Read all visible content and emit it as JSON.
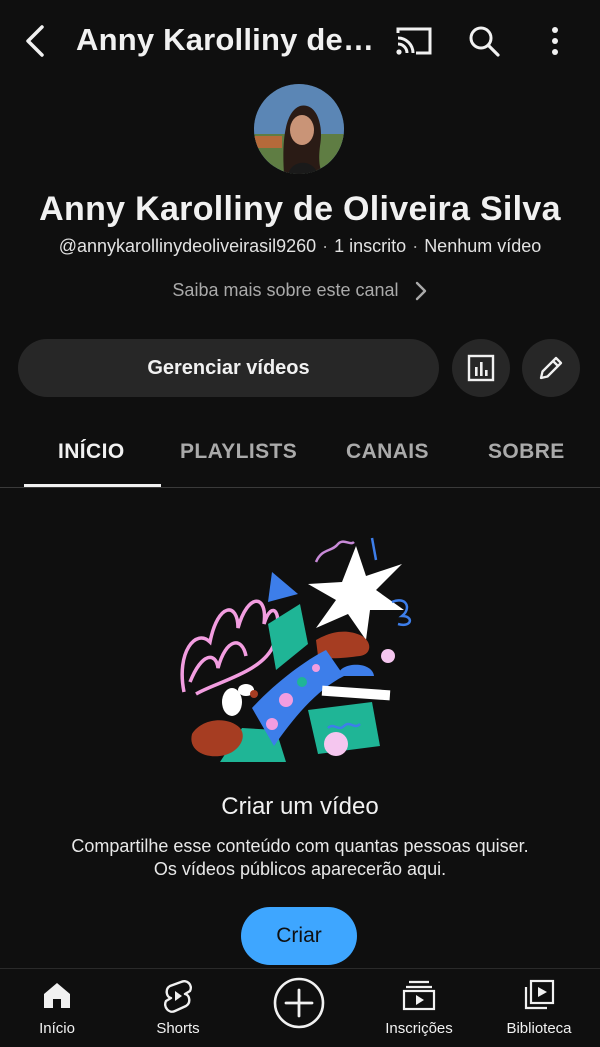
{
  "header": {
    "title": "Anny Karolliny de Oliveira Silva",
    "icons": [
      "back-icon",
      "cast-icon",
      "search-icon",
      "more-vert-icon"
    ]
  },
  "channel": {
    "name": "Anny Karolliny de Oliveira Silva",
    "handle": "@annykarollinydeoliveirasil9260",
    "subscribers": "1 inscrito",
    "videos": "Nenhum vídeo",
    "about_link": "Saiba mais sobre este canal"
  },
  "actions": {
    "manage_videos": "Gerenciar vídeos",
    "icons": [
      "analytics-icon",
      "edit-pencil-icon"
    ]
  },
  "tabs": [
    {
      "label": "INÍCIO",
      "active": true
    },
    {
      "label": "PLAYLISTS",
      "active": false
    },
    {
      "label": "CANAIS",
      "active": false
    },
    {
      "label": "SOBRE",
      "active": false
    }
  ],
  "empty_state": {
    "title": "Criar um vídeo",
    "description_line1": "Compartilhe esse conteúdo com quantas pessoas quiser.",
    "description_line2": "Os vídeos públicos aparecerão aqui.",
    "button": "Criar"
  },
  "bottom_nav": [
    {
      "label": "Início",
      "icon": "home-icon"
    },
    {
      "label": "Shorts",
      "icon": "shorts-icon"
    },
    {
      "label": "",
      "icon": "create-plus-icon"
    },
    {
      "label": "Inscrições",
      "icon": "subscriptions-icon"
    },
    {
      "label": "Biblioteca",
      "icon": "library-icon"
    }
  ],
  "colors": {
    "background": "#0f0f0f",
    "button_bg": "#272727",
    "accent": "#3ea6ff",
    "text": "#f1f1f1",
    "secondary_text": "#aaaaaa"
  }
}
